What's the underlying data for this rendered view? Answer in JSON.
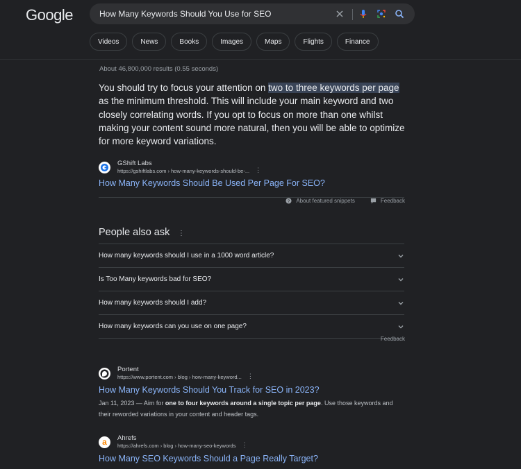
{
  "logo": "Google",
  "search": {
    "query": "How Many Keywords Should You Use for SEO",
    "icons": [
      "clear-icon",
      "mic-icon",
      "lens-icon",
      "search-icon"
    ]
  },
  "tabs": [
    "Videos",
    "News",
    "Books",
    "Images",
    "Maps",
    "Flights",
    "Finance"
  ],
  "stats": "About 46,800,000 results (0.55 seconds)",
  "featured": {
    "text_before": "You should try to focus your attention on ",
    "text_highlight": "two to three keywords per page",
    "text_after": " as the minimum threshold. This will include your main keyword and two closely correlating words. If you opt to focus on more than one whilst making your content sound more natural, then you will be able to optimize for more keyword variations.",
    "source_name": "GShift Labs",
    "source_url": "https://gshiftlabs.com › how-many-keywords-should-be-...",
    "title": "How Many Keywords Should Be Used Per Page For SEO?",
    "about_label": "About featured snippets",
    "feedback_label": "Feedback"
  },
  "paa": {
    "title": "People also ask",
    "questions": [
      "How many keywords should I use in a 1000 word article?",
      "Is Too Many keywords bad for SEO?",
      "How many keywords should I add?",
      "How many keywords can you use on one page?"
    ],
    "feedback_label": "Feedback"
  },
  "results": [
    {
      "source_name": "Portent",
      "source_url": "https://www.portent.com › blog › how-many-keyword...",
      "title": "How Many Keywords Should You Track for SEO in 2023?",
      "date": "Jan 11, 2023",
      "snippet_pre": " — Aim for ",
      "snippet_bold": "one to four keywords around a single topic per page",
      "snippet_post": ". Use those keywords and their reworded variations in your content and header tags.",
      "favicon_color": "#ffffff"
    },
    {
      "source_name": "Ahrefs",
      "source_url": "https://ahrefs.com › blog › how-many-seo-keywords",
      "title": "How Many SEO Keywords Should a Page Really Target?",
      "favicon_letter": "a",
      "favicon_color": "#ff8800"
    }
  ]
}
